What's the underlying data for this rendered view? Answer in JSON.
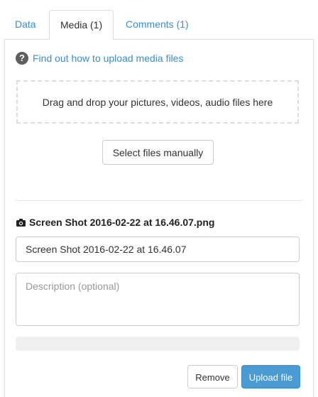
{
  "tabs": [
    {
      "label": "Data",
      "active": false
    },
    {
      "label": "Media (1)",
      "active": true
    },
    {
      "label": "Comments (1)",
      "active": false
    }
  ],
  "help": {
    "icon": "question-circle-icon",
    "link_text": "Find out how to upload media files"
  },
  "dropzone": {
    "text": "Drag and drop your pictures, videos, audio files here"
  },
  "select_button": {
    "label": "Select files manually"
  },
  "file": {
    "icon": "camera-icon",
    "filename": "Screen Shot 2016-02-22 at 16.46.07.png",
    "title_value": "Screen Shot 2016-02-22 at 16.46.07",
    "description_placeholder": "Description (optional)",
    "progress": 0
  },
  "actions": {
    "remove_label": "Remove",
    "upload_label": "Upload file"
  },
  "colors": {
    "link": "#3a8fc7",
    "primary": "#4a9ad3",
    "border": "#dddddd"
  }
}
